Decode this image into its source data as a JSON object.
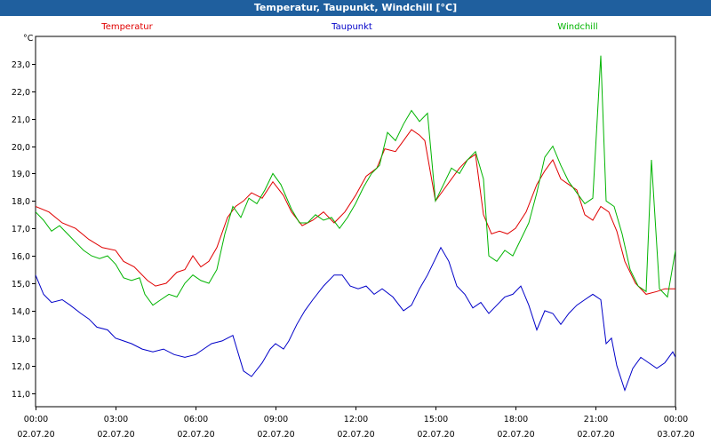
{
  "window": {
    "title": "Temperatur, Taupunkt, Windchill [°C]"
  },
  "chart_data": {
    "type": "line",
    "title": "Temperatur, Taupunkt, Windchill [°C]",
    "ylabel": "°C",
    "xlabel": "",
    "ylim": [
      10.5,
      24.0
    ],
    "xlim": [
      0,
      24
    ],
    "grid": true,
    "y_ticks": [
      "11,0",
      "12,0",
      "13,0",
      "14,0",
      "15,0",
      "16,0",
      "17,0",
      "18,0",
      "19,0",
      "20,0",
      "21,0",
      "22,0",
      "23,0"
    ],
    "x_ticks": [
      {
        "time": "00:00",
        "date": "02.07.20"
      },
      {
        "time": "03:00",
        "date": "02.07.20"
      },
      {
        "time": "06:00",
        "date": "02.07.20"
      },
      {
        "time": "09:00",
        "date": "02.07.20"
      },
      {
        "time": "12:00",
        "date": "02.07.20"
      },
      {
        "time": "15:00",
        "date": "02.07.20"
      },
      {
        "time": "18:00",
        "date": "02.07.20"
      },
      {
        "time": "21:00",
        "date": "02.07.20"
      },
      {
        "time": "00:00",
        "date": "03.07.20"
      }
    ],
    "series": [
      {
        "name": "Temperatur",
        "color": "#e00000",
        "points": [
          [
            0,
            17.8
          ],
          [
            0.5,
            17.6
          ],
          [
            1.0,
            17.2
          ],
          [
            1.5,
            17.0
          ],
          [
            2.0,
            16.6
          ],
          [
            2.5,
            16.3
          ],
          [
            3.0,
            16.2
          ],
          [
            3.3,
            15.8
          ],
          [
            3.7,
            15.6
          ],
          [
            4.2,
            15.1
          ],
          [
            4.5,
            14.9
          ],
          [
            4.9,
            15.0
          ],
          [
            5.3,
            15.4
          ],
          [
            5.6,
            15.5
          ],
          [
            5.9,
            16.0
          ],
          [
            6.2,
            15.6
          ],
          [
            6.5,
            15.8
          ],
          [
            6.8,
            16.3
          ],
          [
            7.2,
            17.4
          ],
          [
            7.5,
            17.8
          ],
          [
            7.8,
            18.0
          ],
          [
            8.1,
            18.3
          ],
          [
            8.5,
            18.1
          ],
          [
            8.9,
            18.7
          ],
          [
            9.3,
            18.2
          ],
          [
            9.6,
            17.6
          ],
          [
            10.0,
            17.1
          ],
          [
            10.4,
            17.3
          ],
          [
            10.8,
            17.6
          ],
          [
            11.2,
            17.2
          ],
          [
            11.6,
            17.6
          ],
          [
            12.0,
            18.2
          ],
          [
            12.4,
            18.9
          ],
          [
            12.8,
            19.2
          ],
          [
            13.1,
            19.9
          ],
          [
            13.5,
            19.8
          ],
          [
            13.8,
            20.2
          ],
          [
            14.1,
            20.6
          ],
          [
            14.4,
            20.4
          ],
          [
            14.6,
            20.2
          ],
          [
            15.0,
            18.0
          ],
          [
            15.3,
            18.4
          ],
          [
            15.6,
            18.8
          ],
          [
            15.9,
            19.2
          ],
          [
            16.2,
            19.5
          ],
          [
            16.5,
            19.7
          ],
          [
            16.8,
            17.5
          ],
          [
            17.1,
            16.8
          ],
          [
            17.4,
            16.9
          ],
          [
            17.7,
            16.8
          ],
          [
            18.0,
            17.0
          ],
          [
            18.4,
            17.6
          ],
          [
            18.8,
            18.6
          ],
          [
            19.1,
            19.1
          ],
          [
            19.4,
            19.5
          ],
          [
            19.7,
            18.8
          ],
          [
            20.0,
            18.6
          ],
          [
            20.3,
            18.4
          ],
          [
            20.6,
            17.5
          ],
          [
            20.9,
            17.3
          ],
          [
            21.2,
            17.8
          ],
          [
            21.5,
            17.6
          ],
          [
            21.8,
            16.9
          ],
          [
            22.1,
            15.8
          ],
          [
            22.5,
            15.0
          ],
          [
            22.9,
            14.6
          ],
          [
            23.3,
            14.7
          ],
          [
            23.6,
            14.8
          ],
          [
            24.0,
            14.8
          ]
        ]
      },
      {
        "name": "Taupunkt",
        "color": "#0000c8",
        "points": [
          [
            0,
            15.3
          ],
          [
            0.3,
            14.6
          ],
          [
            0.6,
            14.3
          ],
          [
            1.0,
            14.4
          ],
          [
            1.3,
            14.2
          ],
          [
            1.7,
            13.9
          ],
          [
            2.0,
            13.7
          ],
          [
            2.3,
            13.4
          ],
          [
            2.7,
            13.3
          ],
          [
            3.0,
            13.0
          ],
          [
            3.3,
            12.9
          ],
          [
            3.6,
            12.8
          ],
          [
            4.0,
            12.6
          ],
          [
            4.4,
            12.5
          ],
          [
            4.8,
            12.6
          ],
          [
            5.2,
            12.4
          ],
          [
            5.6,
            12.3
          ],
          [
            6.0,
            12.4
          ],
          [
            6.3,
            12.6
          ],
          [
            6.6,
            12.8
          ],
          [
            7.0,
            12.9
          ],
          [
            7.4,
            13.1
          ],
          [
            7.8,
            11.8
          ],
          [
            8.1,
            11.6
          ],
          [
            8.5,
            12.1
          ],
          [
            8.8,
            12.6
          ],
          [
            9.0,
            12.8
          ],
          [
            9.3,
            12.6
          ],
          [
            9.5,
            12.9
          ],
          [
            9.8,
            13.5
          ],
          [
            10.1,
            14.0
          ],
          [
            10.4,
            14.4
          ],
          [
            10.8,
            14.9
          ],
          [
            11.2,
            15.3
          ],
          [
            11.5,
            15.3
          ],
          [
            11.8,
            14.9
          ],
          [
            12.1,
            14.8
          ],
          [
            12.4,
            14.9
          ],
          [
            12.7,
            14.6
          ],
          [
            13.0,
            14.8
          ],
          [
            13.4,
            14.5
          ],
          [
            13.8,
            14.0
          ],
          [
            14.1,
            14.2
          ],
          [
            14.4,
            14.8
          ],
          [
            14.7,
            15.3
          ],
          [
            15.0,
            15.9
          ],
          [
            15.2,
            16.3
          ],
          [
            15.5,
            15.8
          ],
          [
            15.8,
            14.9
          ],
          [
            16.1,
            14.6
          ],
          [
            16.4,
            14.1
          ],
          [
            16.7,
            14.3
          ],
          [
            17.0,
            13.9
          ],
          [
            17.3,
            14.2
          ],
          [
            17.6,
            14.5
          ],
          [
            17.9,
            14.6
          ],
          [
            18.2,
            14.9
          ],
          [
            18.5,
            14.2
          ],
          [
            18.8,
            13.3
          ],
          [
            19.1,
            14.0
          ],
          [
            19.4,
            13.9
          ],
          [
            19.7,
            13.5
          ],
          [
            20.0,
            13.9
          ],
          [
            20.3,
            14.2
          ],
          [
            20.6,
            14.4
          ],
          [
            20.9,
            14.6
          ],
          [
            21.2,
            14.4
          ],
          [
            21.4,
            12.8
          ],
          [
            21.6,
            13.0
          ],
          [
            21.8,
            12.0
          ],
          [
            22.1,
            11.1
          ],
          [
            22.4,
            11.9
          ],
          [
            22.7,
            12.3
          ],
          [
            23.0,
            12.1
          ],
          [
            23.3,
            11.9
          ],
          [
            23.6,
            12.1
          ],
          [
            23.9,
            12.5
          ],
          [
            24.0,
            12.3
          ]
        ]
      },
      {
        "name": "Windchill",
        "color": "#00b400",
        "points": [
          [
            0,
            17.6
          ],
          [
            0.3,
            17.3
          ],
          [
            0.6,
            16.9
          ],
          [
            0.9,
            17.1
          ],
          [
            1.2,
            16.8
          ],
          [
            1.5,
            16.5
          ],
          [
            1.8,
            16.2
          ],
          [
            2.1,
            16.0
          ],
          [
            2.4,
            15.9
          ],
          [
            2.7,
            16.0
          ],
          [
            3.0,
            15.7
          ],
          [
            3.3,
            15.2
          ],
          [
            3.6,
            15.1
          ],
          [
            3.9,
            15.2
          ],
          [
            4.1,
            14.6
          ],
          [
            4.4,
            14.2
          ],
          [
            4.7,
            14.4
          ],
          [
            5.0,
            14.6
          ],
          [
            5.3,
            14.5
          ],
          [
            5.6,
            15.0
          ],
          [
            5.9,
            15.3
          ],
          [
            6.2,
            15.1
          ],
          [
            6.5,
            15.0
          ],
          [
            6.8,
            15.5
          ],
          [
            7.1,
            16.8
          ],
          [
            7.4,
            17.8
          ],
          [
            7.7,
            17.4
          ],
          [
            8.0,
            18.1
          ],
          [
            8.3,
            17.9
          ],
          [
            8.6,
            18.4
          ],
          [
            8.9,
            19.0
          ],
          [
            9.2,
            18.6
          ],
          [
            9.6,
            17.7
          ],
          [
            9.9,
            17.2
          ],
          [
            10.2,
            17.2
          ],
          [
            10.5,
            17.5
          ],
          [
            10.8,
            17.3
          ],
          [
            11.1,
            17.4
          ],
          [
            11.4,
            17.0
          ],
          [
            11.7,
            17.4
          ],
          [
            12.0,
            17.9
          ],
          [
            12.3,
            18.5
          ],
          [
            12.6,
            19.0
          ],
          [
            12.9,
            19.3
          ],
          [
            13.2,
            20.5
          ],
          [
            13.5,
            20.2
          ],
          [
            13.8,
            20.8
          ],
          [
            14.1,
            21.3
          ],
          [
            14.4,
            20.9
          ],
          [
            14.7,
            21.2
          ],
          [
            15.0,
            18.0
          ],
          [
            15.3,
            18.6
          ],
          [
            15.6,
            19.2
          ],
          [
            15.9,
            19.0
          ],
          [
            16.2,
            19.5
          ],
          [
            16.5,
            19.8
          ],
          [
            16.8,
            18.8
          ],
          [
            17.0,
            16.0
          ],
          [
            17.3,
            15.8
          ],
          [
            17.6,
            16.2
          ],
          [
            17.9,
            16.0
          ],
          [
            18.2,
            16.6
          ],
          [
            18.5,
            17.2
          ],
          [
            18.8,
            18.3
          ],
          [
            19.1,
            19.6
          ],
          [
            19.4,
            20.0
          ],
          [
            19.7,
            19.3
          ],
          [
            20.0,
            18.7
          ],
          [
            20.3,
            18.3
          ],
          [
            20.6,
            17.9
          ],
          [
            20.9,
            18.1
          ],
          [
            21.2,
            23.3
          ],
          [
            21.4,
            18.0
          ],
          [
            21.7,
            17.8
          ],
          [
            22.0,
            16.8
          ],
          [
            22.3,
            15.5
          ],
          [
            22.6,
            14.9
          ],
          [
            22.9,
            14.7
          ],
          [
            23.1,
            19.5
          ],
          [
            23.4,
            14.8
          ],
          [
            23.7,
            14.5
          ],
          [
            24.0,
            16.2
          ],
          [
            24.2,
            15.2
          ]
        ]
      }
    ]
  }
}
